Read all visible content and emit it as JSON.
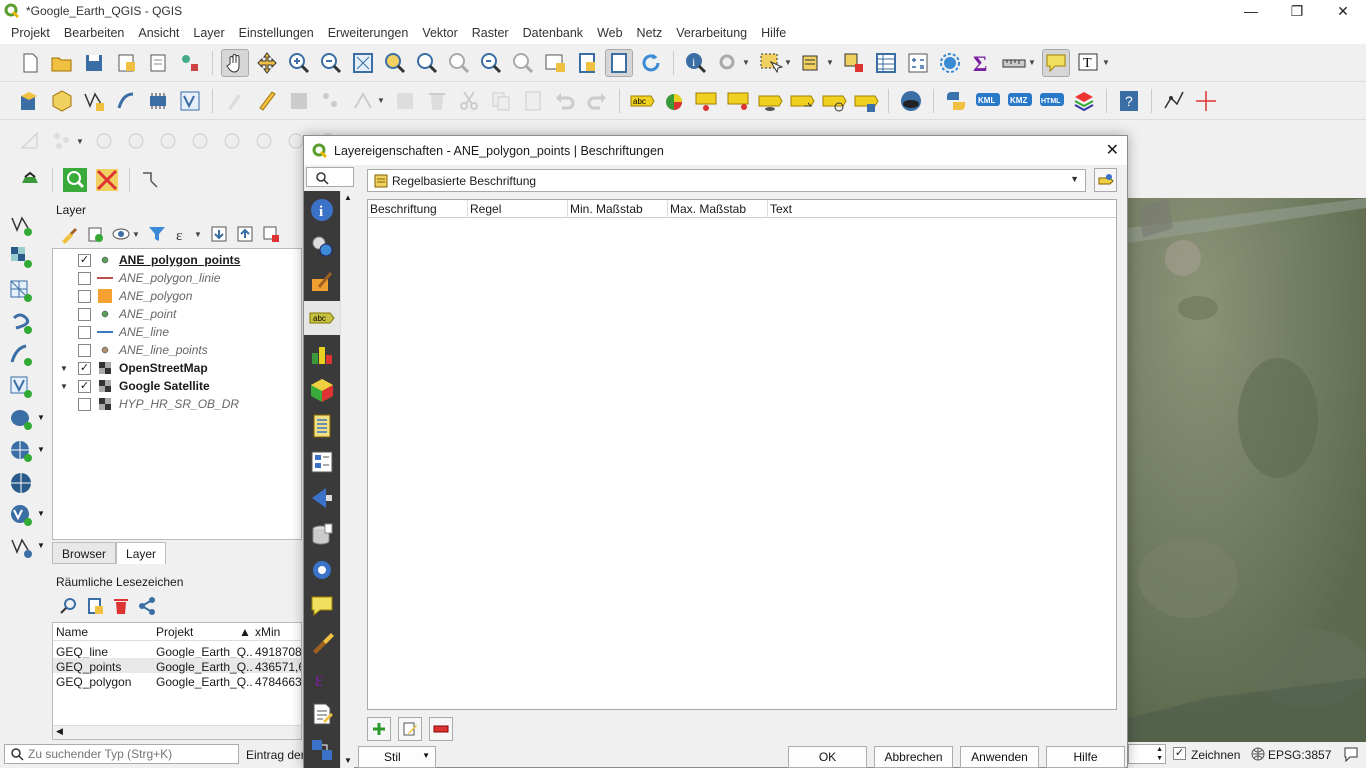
{
  "window": {
    "title": "*Google_Earth_QGIS - QGIS"
  },
  "menu": [
    "Projekt",
    "Bearbeiten",
    "Ansicht",
    "Layer",
    "Einstellungen",
    "Erweiterungen",
    "Vektor",
    "Raster",
    "Datenbank",
    "Web",
    "Netz",
    "Verarbeitung",
    "Hilfe"
  ],
  "layer_panel": {
    "title": "Layer",
    "layers": [
      {
        "name": "ANE_polygon_points",
        "checked": true,
        "style": "bold-ul",
        "symbol": "point-green"
      },
      {
        "name": "ANE_polygon_linie",
        "checked": false,
        "style": "italic",
        "symbol": "line-red"
      },
      {
        "name": "ANE_polygon",
        "checked": false,
        "style": "italic",
        "symbol": "fill-orange"
      },
      {
        "name": "ANE_point",
        "checked": false,
        "style": "italic",
        "symbol": "point-green"
      },
      {
        "name": "ANE_line",
        "checked": false,
        "style": "italic",
        "symbol": "line-blue"
      },
      {
        "name": "ANE_line_points",
        "checked": false,
        "style": "italic",
        "symbol": "point-brown"
      },
      {
        "name": "OpenStreetMap",
        "checked": true,
        "style": "bold",
        "symbol": "raster",
        "expand": true
      },
      {
        "name": "Google Satellite",
        "checked": true,
        "style": "bold",
        "symbol": "raster",
        "expand": true
      },
      {
        "name": "HYP_HR_SR_OB_DR",
        "checked": false,
        "style": "italic",
        "symbol": "raster"
      }
    ]
  },
  "tabs": {
    "browser": "Browser",
    "layer": "Layer"
  },
  "bookmarks": {
    "title": "Räumliche Lesezeichen",
    "headers": {
      "name": "Name",
      "project": "Projekt",
      "xmin": "xMin"
    },
    "rows": [
      {
        "name": "GEQ_line",
        "project": "Google_Earth_Q...",
        "xmin": "4918708,"
      },
      {
        "name": "GEQ_points",
        "project": "Google_Earth_Q...",
        "xmin": "436571,6"
      },
      {
        "name": "GEQ_polygon",
        "project": "Google_Earth_Q...",
        "xmin": "4784663,"
      }
    ]
  },
  "status": {
    "locator_placeholder": "Zu suchender Typ (Strg+K)",
    "message": "Eintrag der",
    "render_label": "Zeichnen",
    "crs": "EPSG:3857"
  },
  "dialog": {
    "title": "Layereigenschaften - ANE_polygon_points | Beschriftungen",
    "mode": "Regelbasierte Beschriftung",
    "columns": [
      "Beschriftung",
      "Regel",
      "Min. Maßstab",
      "Max. Maßstab",
      "Text"
    ],
    "stil": "Stil",
    "ok": "OK",
    "cancel": "Abbrechen",
    "apply": "Anwenden",
    "help": "Hilfe",
    "abc": "abc"
  }
}
